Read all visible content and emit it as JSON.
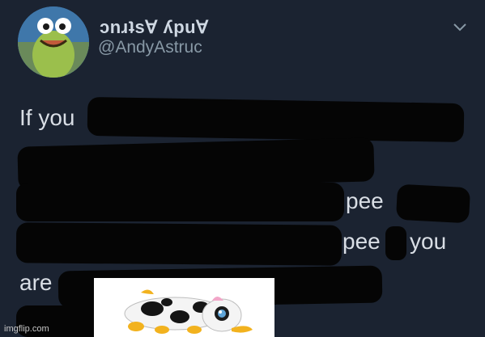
{
  "tweet": {
    "display_name": "ɔnɹʇs∀ ʎpu∀",
    "handle": "@AndyAstruc",
    "lines": {
      "l1_start": "If you",
      "l3_pee": "pee",
      "l4_pee": "pee",
      "l4_you": "you",
      "l5_are": "are"
    }
  },
  "watermark": "imgflip.com",
  "icons": {
    "menu": "chevron-down-icon",
    "avatar": "cartoon-character-avatar",
    "sticker": "cow-plush-sticker"
  },
  "colors": {
    "background": "#1b2331",
    "redaction": "#050505",
    "text": "#d9dee5"
  }
}
